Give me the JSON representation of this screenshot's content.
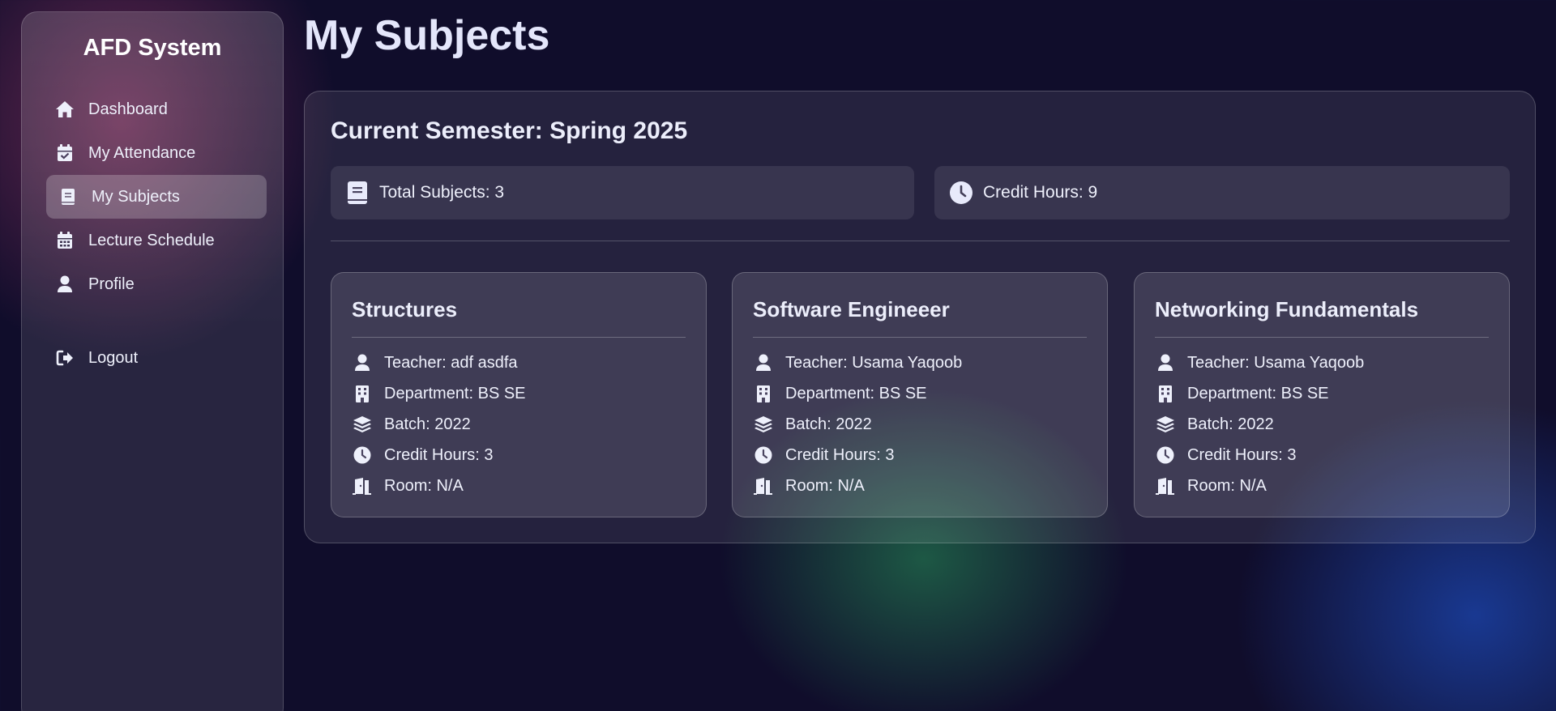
{
  "sidebar": {
    "brand": "AFD System",
    "items": [
      {
        "label": "Dashboard",
        "icon": "home-icon"
      },
      {
        "label": "My Attendance",
        "icon": "calendar-check-icon"
      },
      {
        "label": "My Subjects",
        "icon": "book-icon",
        "active": true
      },
      {
        "label": "Lecture Schedule",
        "icon": "calendar-icon"
      },
      {
        "label": "Profile",
        "icon": "user-icon"
      }
    ],
    "logout": {
      "label": "Logout",
      "icon": "sign-out-icon"
    }
  },
  "page": {
    "title": "My Subjects"
  },
  "semester": {
    "title": "Current Semester: Spring 2025"
  },
  "stats": {
    "total_subjects": "Total Subjects: 3",
    "credit_hours": "Credit Hours: 9"
  },
  "subjects": [
    {
      "name": "Structures",
      "teacher": "Teacher: adf asdfa",
      "department": "Department: BS SE",
      "batch": "Batch: 2022",
      "credit_hours": "Credit Hours: 3",
      "room": "Room: N/A"
    },
    {
      "name": "Software Engineeer",
      "teacher": "Teacher: Usama Yaqoob",
      "department": "Department: BS SE",
      "batch": "Batch: 2022",
      "credit_hours": "Credit Hours: 3",
      "room": "Room: N/A"
    },
    {
      "name": "Networking Fundamentals",
      "teacher": "Teacher: Usama Yaqoob",
      "department": "Department: BS SE",
      "batch": "Batch: 2022",
      "credit_hours": "Credit Hours: 3",
      "room": "Room: N/A"
    }
  ],
  "colors": {
    "background": "#100d2b",
    "text": "#e6e8f7",
    "accent_pink": "#aa3c6e",
    "accent_green": "#28965a",
    "accent_blue": "#1e50c8"
  }
}
